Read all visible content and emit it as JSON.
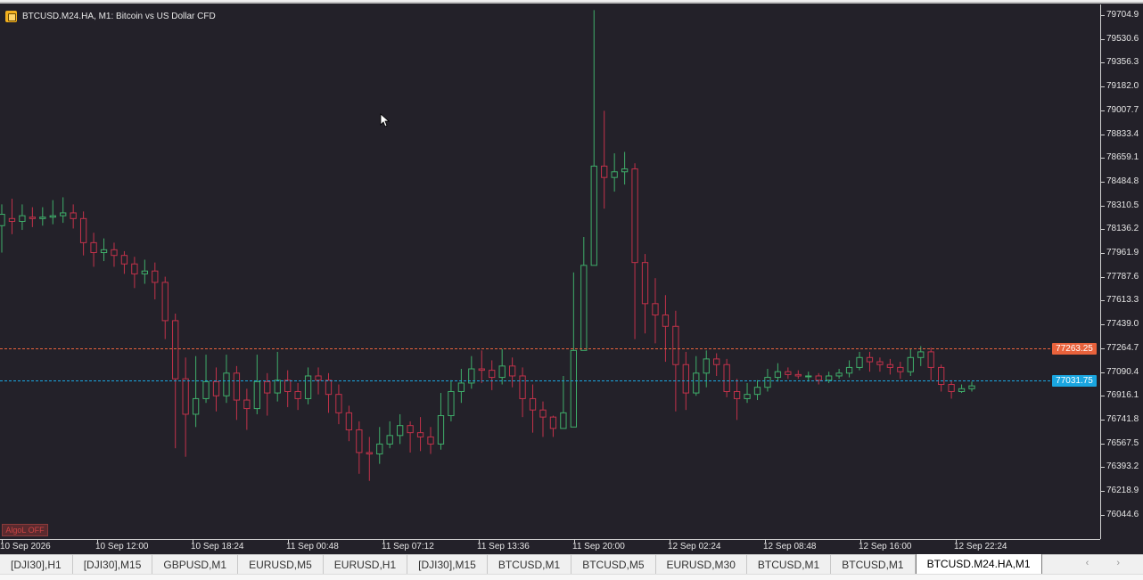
{
  "window": {
    "title": "BTCUSD.M24.HA, M1:  Bitcoin vs US Dollar CFD"
  },
  "price_axis": {
    "labels": [
      "79704.9",
      "79530.6",
      "79356.3",
      "79182.0",
      "79007.7",
      "78833.4",
      "78659.1",
      "78484.8",
      "78310.5",
      "78136.2",
      "77961.9",
      "77787.6",
      "77613.3",
      "77439.0",
      "77264.7",
      "77090.4",
      "76916.1",
      "76741.8",
      "76567.5",
      "76393.2",
      "76218.9",
      "76044.6"
    ]
  },
  "time_axis": {
    "labels": [
      "10 Sep 2026",
      "10 Sep 12:00",
      "10 Sep 18:24",
      "11 Sep 00:48",
      "11 Sep 07:12",
      "11 Sep 13:36",
      "11 Sep 20:00",
      "12 Sep 02:24",
      "12 Sep 08:48",
      "12 Sep 16:00",
      "12 Sep 22:24"
    ]
  },
  "levels": {
    "ask_price": "77263.25",
    "bid_price": "77031.75",
    "ask_color": "#e8623c",
    "bid_color": "#1aa6e0"
  },
  "algo_button": "AlgoL OFF",
  "colors": {
    "background": "#232129",
    "bull": "#3fae6a",
    "bear": "#c2324a"
  },
  "tabs": [
    {
      "label": "[DJI30],H1",
      "active": false
    },
    {
      "label": "[DJI30],M15",
      "active": false
    },
    {
      "label": "GBPUSD,M1",
      "active": false
    },
    {
      "label": "EURUSD,M5",
      "active": false
    },
    {
      "label": "EURUSD,H1",
      "active": false
    },
    {
      "label": "[DJI30],M15",
      "active": false
    },
    {
      "label": "BTCUSD,M1",
      "active": false
    },
    {
      "label": "BTCUSD,M5",
      "active": false
    },
    {
      "label": "EURUSD,M30",
      "active": false
    },
    {
      "label": "BTCUSD,M1",
      "active": false
    },
    {
      "label": "BTCUSD,M1",
      "active": false
    },
    {
      "label": "BTCUSD.M24.HA,M1",
      "active": true
    }
  ],
  "tab_scroll": "‹ ›",
  "chart_data": {
    "type": "candlestick",
    "title": "BTCUSD.M24.HA, M1:  Bitcoin vs US Dollar CFD",
    "ylim": [
      75970,
      79740
    ],
    "candles": [
      [
        78180,
        78260,
        77990,
        78330
      ],
      [
        78230,
        78210,
        78120,
        78370
      ],
      [
        78210,
        78250,
        78150,
        78330
      ],
      [
        78240,
        78230,
        78170,
        78310
      ],
      [
        78230,
        78240,
        78180,
        78310
      ],
      [
        78240,
        78250,
        78190,
        78360
      ],
      [
        78250,
        78270,
        78200,
        78380
      ],
      [
        78270,
        78230,
        78160,
        78330
      ],
      [
        78230,
        78060,
        77970,
        78280
      ],
      [
        78060,
        77990,
        77890,
        78130
      ],
      [
        77990,
        78010,
        77930,
        78090
      ],
      [
        78010,
        77970,
        77890,
        78060
      ],
      [
        77970,
        77910,
        77840,
        78000
      ],
      [
        77910,
        77840,
        77740,
        77960
      ],
      [
        77840,
        77860,
        77770,
        77940
      ],
      [
        77860,
        77780,
        77660,
        77920
      ],
      [
        77780,
        77510,
        77380,
        77820
      ],
      [
        77510,
        77100,
        76610,
        77560
      ],
      [
        77100,
        76850,
        76550,
        77250
      ],
      [
        76850,
        76960,
        76760,
        77260
      ],
      [
        76960,
        77080,
        76930,
        77270
      ],
      [
        77080,
        76980,
        76870,
        77180
      ],
      [
        76980,
        77140,
        76930,
        77270
      ],
      [
        77140,
        76950,
        76810,
        77190
      ],
      [
        76950,
        76890,
        76740,
        77030
      ],
      [
        76890,
        77080,
        76850,
        77270
      ],
      [
        77080,
        77000,
        76840,
        77140
      ],
      [
        77000,
        77090,
        76940,
        77290
      ],
      [
        77090,
        77010,
        76900,
        77160
      ],
      [
        77010,
        76960,
        76880,
        77070
      ],
      [
        76960,
        77120,
        76920,
        77180
      ],
      [
        77120,
        77090,
        76990,
        77180
      ],
      [
        77090,
        76990,
        76860,
        77140
      ],
      [
        76990,
        76860,
        76780,
        77060
      ],
      [
        76860,
        76740,
        76660,
        76910
      ],
      [
        76740,
        76580,
        76430,
        76800
      ],
      [
        76580,
        76570,
        76380,
        76690
      ],
      [
        76570,
        76640,
        76500,
        76760
      ],
      [
        76640,
        76700,
        76610,
        76800
      ],
      [
        76700,
        76770,
        76640,
        76850
      ],
      [
        76770,
        76720,
        76580,
        76800
      ],
      [
        76720,
        76690,
        76590,
        76830
      ],
      [
        76690,
        76640,
        76570,
        76760
      ],
      [
        76640,
        76840,
        76600,
        77000
      ],
      [
        76840,
        77010,
        76800,
        77090
      ],
      [
        77010,
        77070,
        76930,
        77170
      ],
      [
        77070,
        77170,
        77030,
        77260
      ],
      [
        77170,
        77160,
        77070,
        77300
      ],
      [
        77160,
        77110,
        77020,
        77230
      ],
      [
        77110,
        77190,
        77060,
        77310
      ],
      [
        77190,
        77120,
        77040,
        77250
      ],
      [
        77120,
        76960,
        76830,
        77180
      ],
      [
        76960,
        76880,
        76720,
        77060
      ],
      [
        76880,
        76830,
        76690,
        76940
      ],
      [
        76830,
        76750,
        76690,
        76840
      ],
      [
        76750,
        76860,
        76750,
        77120
      ],
      [
        76760,
        77300,
        76760,
        77850
      ],
      [
        77300,
        77900,
        77300,
        78100
      ],
      [
        77900,
        78600,
        77900,
        79700
      ],
      [
        78600,
        78520,
        78300,
        78990
      ],
      [
        78520,
        78560,
        78420,
        78690
      ],
      [
        78560,
        78580,
        78470,
        78700
      ],
      [
        78580,
        77920,
        77380,
        78620
      ],
      [
        77920,
        77630,
        77420,
        77980
      ],
      [
        77630,
        77550,
        77350,
        77810
      ],
      [
        77550,
        77470,
        77220,
        77690
      ],
      [
        77470,
        77200,
        76870,
        77580
      ],
      [
        77200,
        77000,
        76880,
        77290
      ],
      [
        77000,
        77140,
        76980,
        77260
      ],
      [
        77140,
        77240,
        77040,
        77300
      ],
      [
        77240,
        77200,
        77120,
        77280
      ],
      [
        77200,
        77010,
        76970,
        77240
      ],
      [
        77010,
        76960,
        76810,
        77100
      ],
      [
        76960,
        76990,
        76930,
        77070
      ],
      [
        76990,
        77040,
        76950,
        77090
      ],
      [
        77040,
        77110,
        77010,
        77170
      ],
      [
        77110,
        77150,
        77080,
        77210
      ],
      [
        77150,
        77130,
        77100,
        77180
      ],
      [
        77130,
        77120,
        77100,
        77160
      ],
      [
        77120,
        77120,
        77080,
        77150
      ],
      [
        77120,
        77090,
        77060,
        77140
      ],
      [
        77090,
        77120,
        77070,
        77150
      ],
      [
        77120,
        77140,
        77100,
        77170
      ],
      [
        77140,
        77180,
        77110,
        77230
      ],
      [
        77180,
        77250,
        77160,
        77290
      ],
      [
        77250,
        77220,
        77150,
        77290
      ],
      [
        77220,
        77200,
        77150,
        77250
      ],
      [
        77200,
        77180,
        77130,
        77240
      ],
      [
        77180,
        77150,
        77100,
        77220
      ],
      [
        77150,
        77250,
        77120,
        77310
      ],
      [
        77250,
        77290,
        77190,
        77330
      ],
      [
        77290,
        77180,
        77090,
        77320
      ],
      [
        77180,
        77060,
        77010,
        77200
      ],
      [
        77060,
        77010,
        76960,
        77090
      ],
      [
        77010,
        77030,
        77000,
        77060
      ],
      [
        77030,
        77050,
        77010,
        77080
      ]
    ]
  }
}
